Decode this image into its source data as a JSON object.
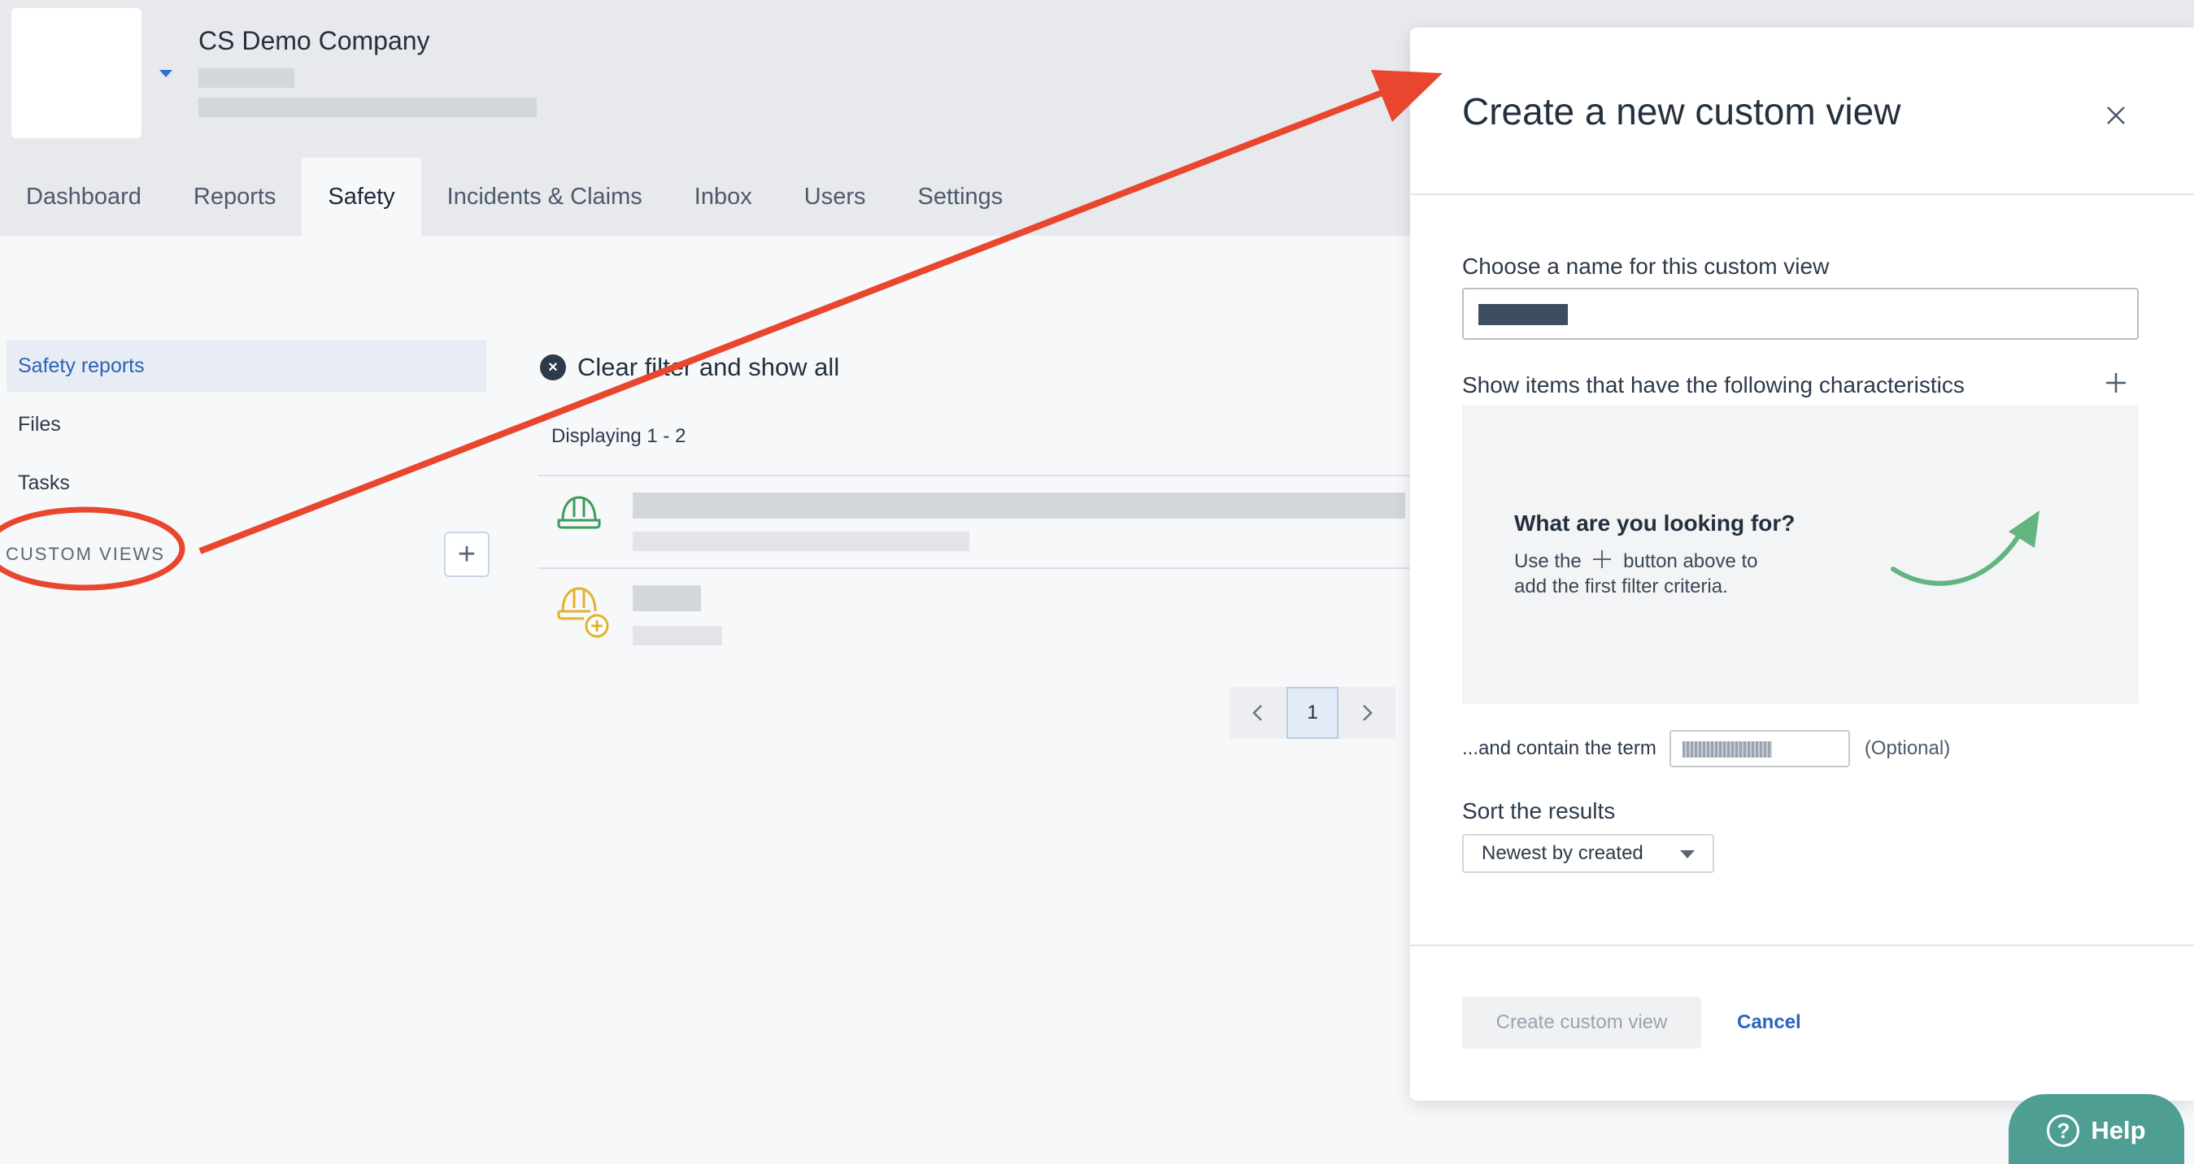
{
  "header": {
    "company_name": "CS Demo Company"
  },
  "tabs": [
    {
      "label": "Dashboard"
    },
    {
      "label": "Reports"
    },
    {
      "label": "Safety"
    },
    {
      "label": "Incidents & Claims"
    },
    {
      "label": "Inbox"
    },
    {
      "label": "Users"
    },
    {
      "label": "Settings"
    }
  ],
  "active_tab": "Safety",
  "sidebar": {
    "items": [
      {
        "label": "Safety reports"
      },
      {
        "label": "Files"
      },
      {
        "label": "Tasks"
      }
    ],
    "custom_views_label": "CUSTOM VIEWS",
    "add_icon": "plus-icon"
  },
  "main": {
    "clear_filter_label": "Clear filter and show all",
    "displaying_text": "Displaying 1 - 2",
    "pagination": {
      "current_page": "1"
    }
  },
  "modal": {
    "title": "Create a new custom view",
    "name_label": "Choose a name for this custom view",
    "characteristics_label": "Show items that have the following characteristics",
    "empty_state_title": "What are you looking for?",
    "empty_state_line1_a": "Use the",
    "empty_state_line1_b": "button above to",
    "empty_state_line2": "add the first filter criteria.",
    "contain_label": "...and contain the term",
    "optional_label": "(Optional)",
    "sort_label": "Sort the results",
    "sort_value": "Newest by created",
    "create_button": "Create custom view",
    "cancel_button": "Cancel"
  },
  "help": {
    "label": "Help"
  },
  "colors": {
    "accent_blue": "#2a64c0",
    "annotation_red": "#e8462e",
    "help_teal": "#4f9e94",
    "safe_green": "#3e9b5a",
    "warn_yellow": "#e3b22b",
    "arrow_green": "#63b47f"
  }
}
